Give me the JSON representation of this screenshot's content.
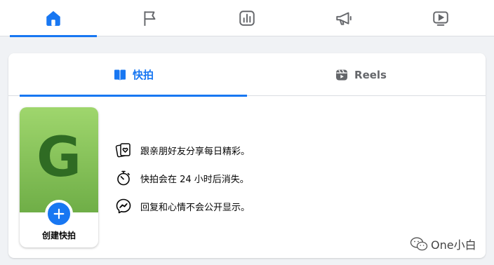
{
  "top_nav": {
    "tabs": [
      {
        "icon": "home-icon",
        "active": true
      },
      {
        "icon": "flag-icon",
        "active": false
      },
      {
        "icon": "bar-chart-icon",
        "active": false
      },
      {
        "icon": "megaphone-icon",
        "active": false
      },
      {
        "icon": "video-play-icon",
        "active": false
      }
    ],
    "accent_color": "#1877f2"
  },
  "story_tabs": {
    "stories_label": "快拍",
    "reels_label": "Reels",
    "active": "stories"
  },
  "create_story": {
    "avatar_letter": "G",
    "label": "创建快拍"
  },
  "features": [
    {
      "icon": "photo-heart-icon",
      "text": "跟亲朋好友分享每日精彩。"
    },
    {
      "icon": "stopwatch-icon",
      "text": "快拍会在 24 小时后消失。"
    },
    {
      "icon": "messenger-icon",
      "text": "回复和心情不会公开显示。"
    }
  ],
  "watermark": {
    "text": "One小白"
  }
}
